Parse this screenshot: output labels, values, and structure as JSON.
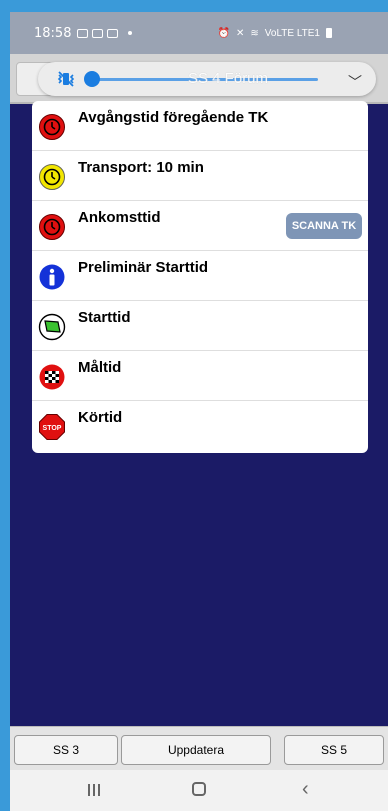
{
  "status_bar": {
    "time": "18:58",
    "signal_text": "VoLTE LTE1"
  },
  "toolbar": {
    "stage_title": "SS 4 Förum"
  },
  "list": {
    "items": [
      {
        "label": "Avgångstid föregående TK",
        "icon": "red-clock-icon"
      },
      {
        "label": "Transport: 10 min",
        "icon": "yellow-clock-icon"
      },
      {
        "label": "Ankomsttid",
        "icon": "red-clock-icon",
        "button": "SCANNA TK"
      },
      {
        "label": "Preliminär Starttid",
        "icon": "info-icon"
      },
      {
        "label": "Starttid",
        "icon": "green-flag-icon"
      },
      {
        "label": "Måltid",
        "icon": "checkered-flag-icon"
      },
      {
        "label": "Körtid",
        "icon": "stop-sign-icon"
      }
    ]
  },
  "bottom_bar": {
    "prev_label": "SS 3",
    "update_label": "Uppdatera",
    "next_label": "SS 5"
  },
  "colors": {
    "background": "#1b1b66",
    "accent": "#1b7de0",
    "scan_button": "#7e95b6"
  }
}
